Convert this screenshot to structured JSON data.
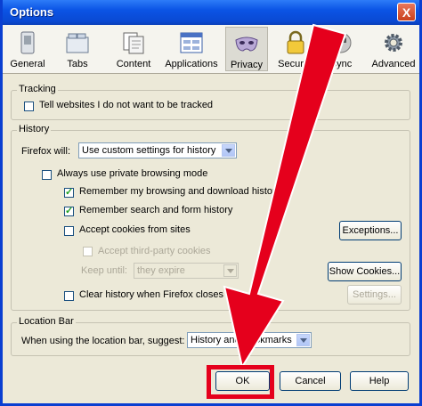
{
  "window": {
    "title": "Options",
    "close": "X"
  },
  "toolbar": [
    {
      "label": "General",
      "icon": "switch-icon"
    },
    {
      "label": "Tabs",
      "icon": "folder-tabs-icon"
    },
    {
      "label": "Content",
      "icon": "documents-icon"
    },
    {
      "label": "Applications",
      "icon": "application-window-icon"
    },
    {
      "label": "Privacy",
      "icon": "mask-icon",
      "selected": true
    },
    {
      "label": "Security",
      "icon": "padlock-icon"
    },
    {
      "label": "Sync",
      "icon": "sync-icon"
    },
    {
      "label": "Advanced",
      "icon": "gear-icon"
    }
  ],
  "tracking": {
    "title": "Tracking",
    "dnt_label": "Tell websites I do not want to be tracked",
    "dnt_checked": false
  },
  "history": {
    "title": "History",
    "will_label": "Firefox will:",
    "will_value": "Use custom settings for history",
    "private_label": "Always use private browsing mode",
    "private_checked": false,
    "remember_browsing_label": "Remember my browsing and download history",
    "remember_browsing_checked": true,
    "remember_search_label": "Remember search and form history",
    "remember_search_checked": true,
    "cookies_label": "Accept cookies from sites",
    "cookies_checked": false,
    "third_party_label": "Accept third-party cookies",
    "keep_until_label": "Keep until:",
    "keep_until_value": "they expire",
    "clear_label": "Clear history when Firefox closes",
    "clear_checked": false,
    "exceptions_button": "Exceptions...",
    "show_cookies_button": "Show Cookies...",
    "settings_button": "Settings..."
  },
  "location_bar": {
    "title": "Location Bar",
    "suggest_label": "When using the location bar, suggest:",
    "suggest_value": "History and Bookmarks"
  },
  "buttons": {
    "ok": "OK",
    "cancel": "Cancel",
    "help": "Help"
  },
  "annotation": {
    "arrow_color": "#e5001c"
  }
}
